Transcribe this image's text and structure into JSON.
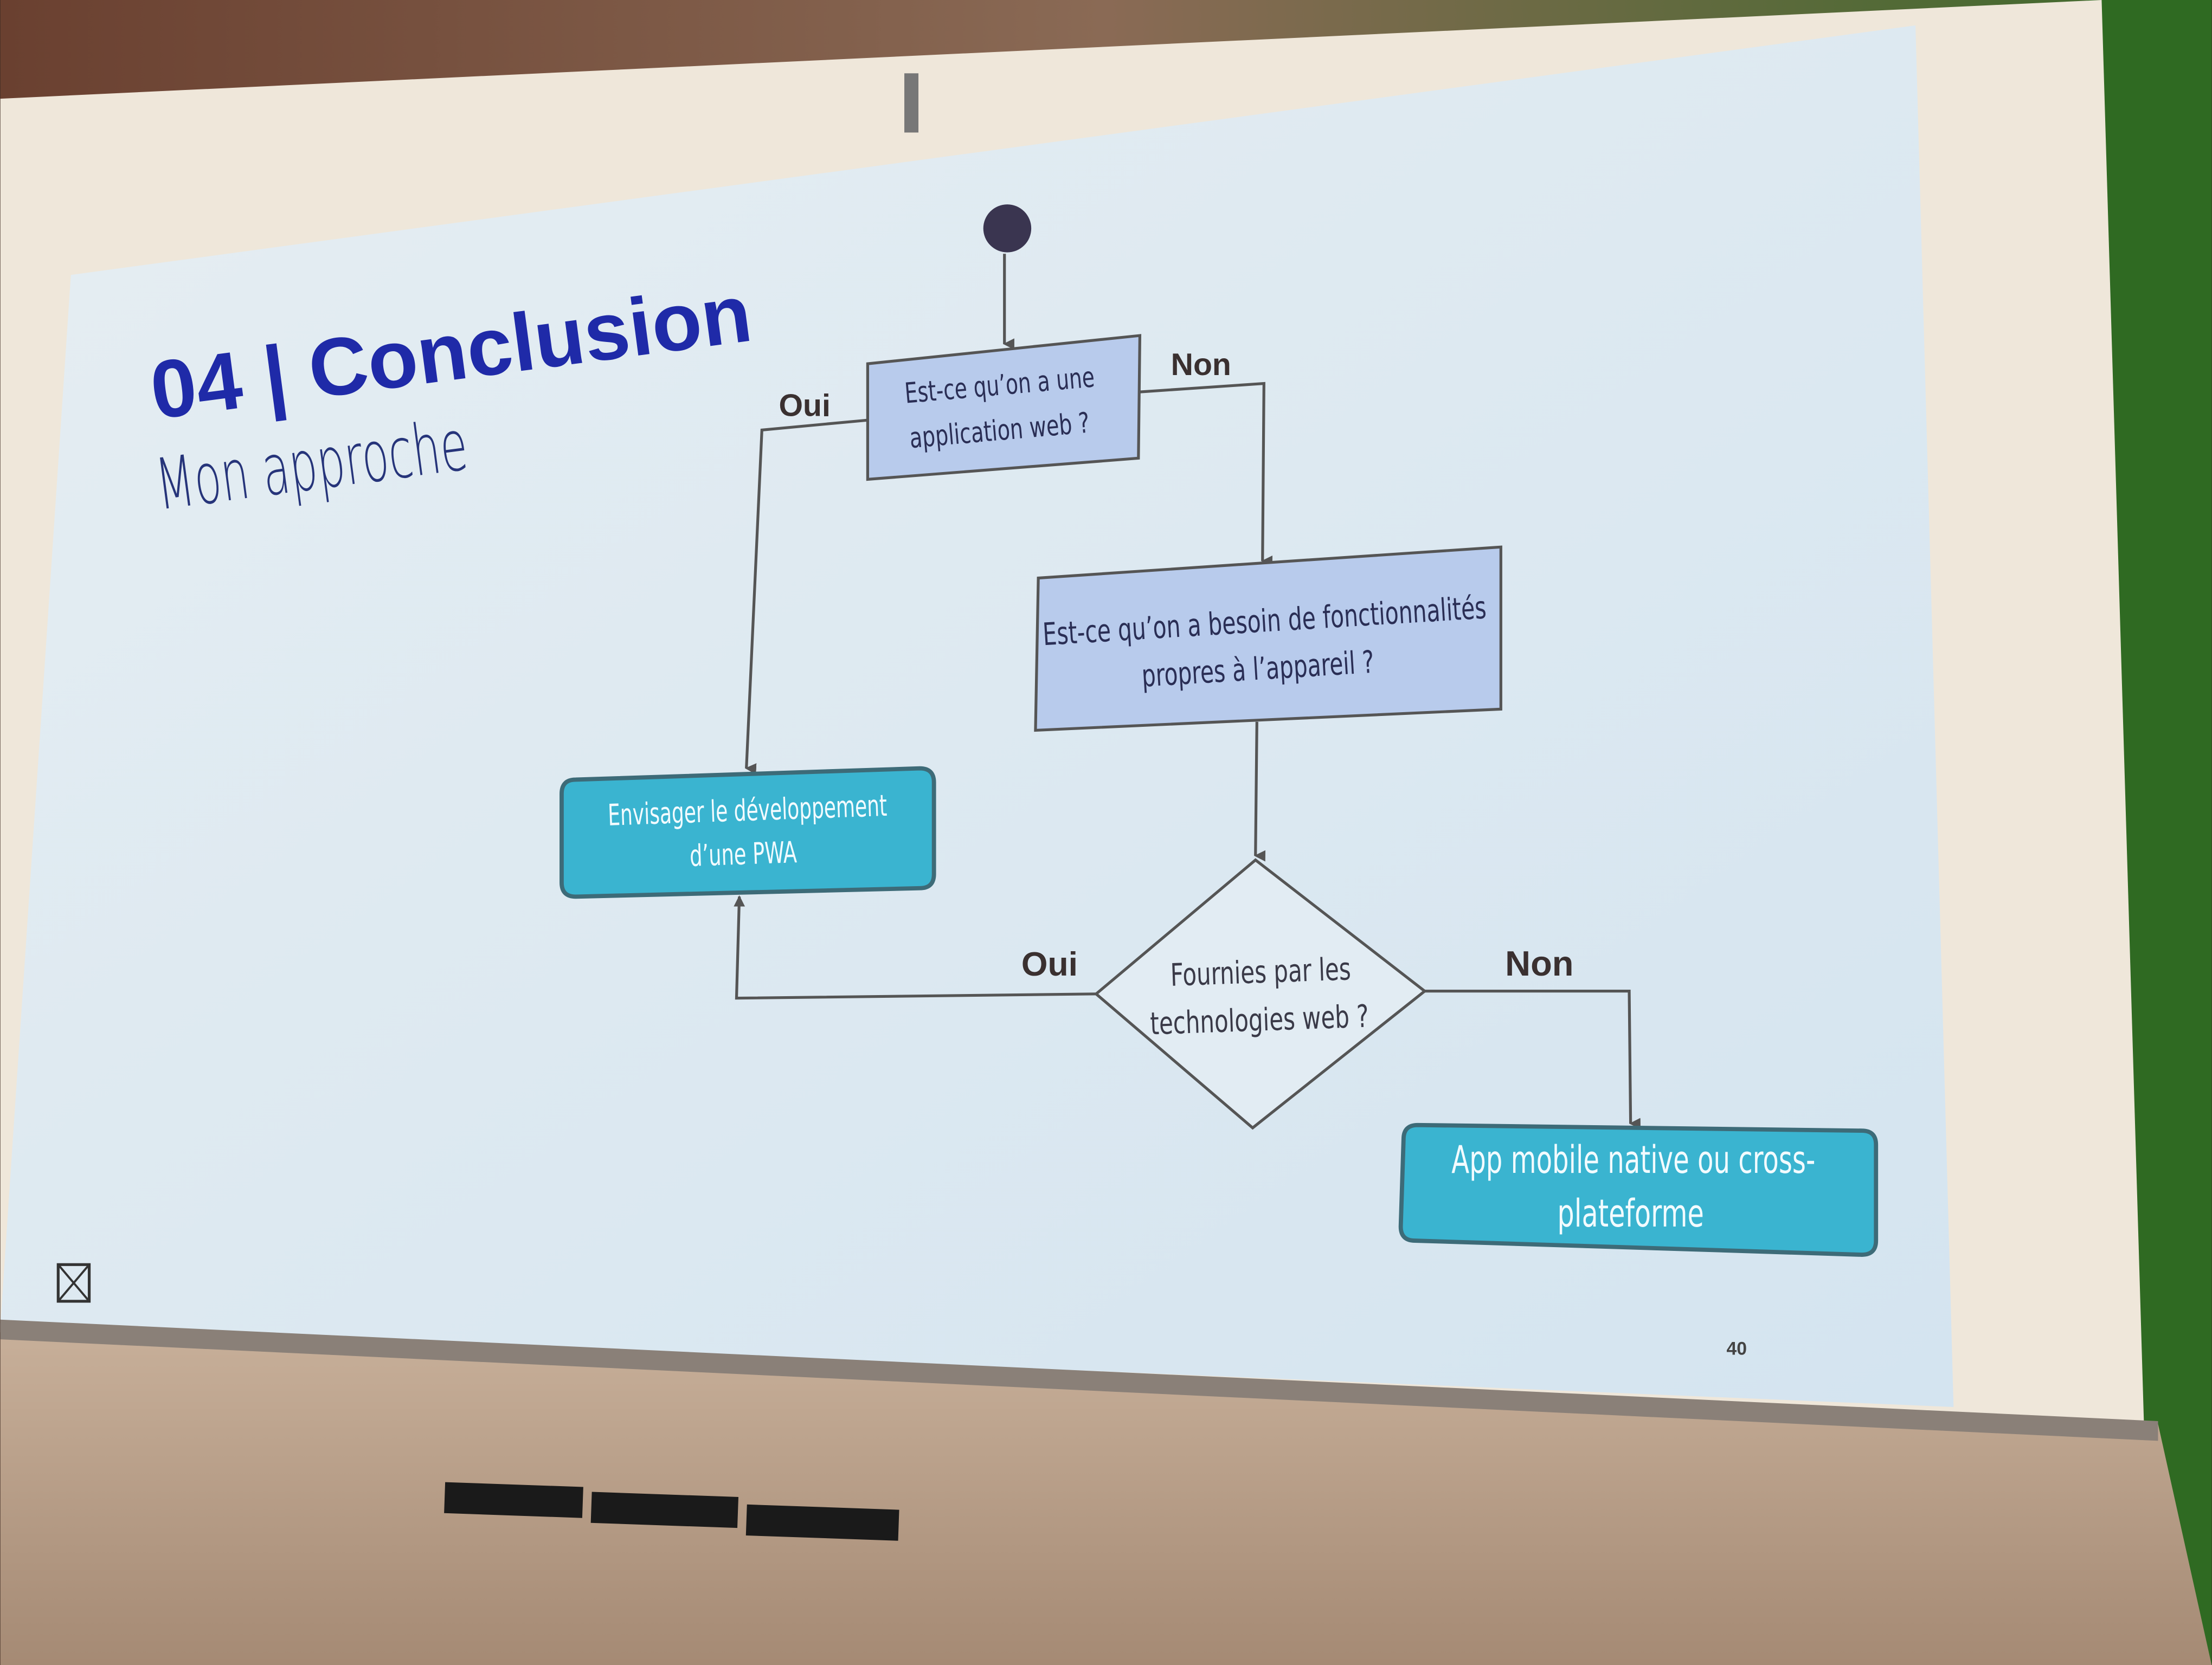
{
  "slide": {
    "title": "04 | Conclusion",
    "subtitle": "Mon approche",
    "page_number": "40"
  },
  "flowchart": {
    "q1": {
      "line1": "Est-ce qu’on a une",
      "line2": "application web ?"
    },
    "q2": {
      "line1": "Est-ce qu’on a besoin de fonctionnalités",
      "line2": "propres à l’appareil ?"
    },
    "q3": {
      "line1": "Fournies par les",
      "line2": "technologies web ?"
    },
    "pwa": {
      "line1": "Envisager le développement",
      "line2": "d’une PWA"
    },
    "native": {
      "line1": "App mobile native ou cross-",
      "line2": "plateforme"
    },
    "labels": {
      "q1_yes": "Oui",
      "q1_no": "Non",
      "q3_yes": "Oui",
      "q3_no": "Non"
    }
  },
  "colors": {
    "title": "#1f2aa8",
    "question_fill": "#b8cbec",
    "result_fill": "#3ab4d0",
    "slide_bg": "#dde9f2"
  }
}
